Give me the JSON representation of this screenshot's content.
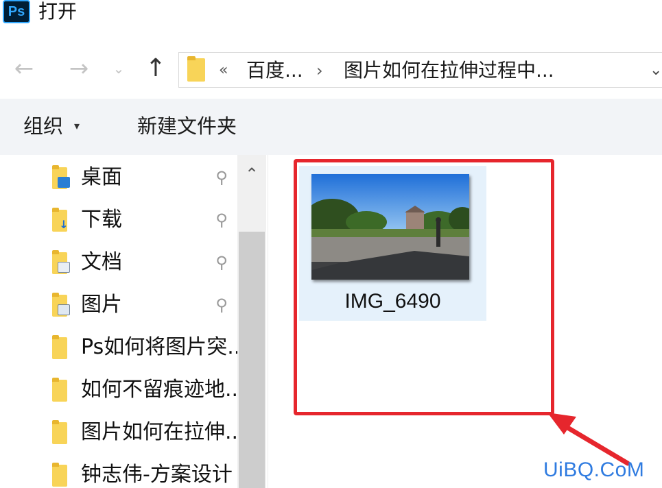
{
  "window": {
    "app_icon": "photoshop-icon",
    "app_icon_text": "Ps",
    "title": "打开"
  },
  "nav": {
    "back_icon": "arrow-left-icon",
    "forward_icon": "arrow-right-icon",
    "recent_icon": "chevron-down-icon",
    "up_icon": "arrow-up-icon",
    "address": {
      "overflow_symbol": "«",
      "segments": [
        "百度...",
        "图片如何在拉伸过程中..."
      ],
      "separator": "›",
      "dropdown_icon": "chevron-down-icon"
    }
  },
  "toolbar": {
    "organize_label": "组织",
    "organize_caret": "▾",
    "new_folder_label": "新建文件夹"
  },
  "sidebar": {
    "items": [
      {
        "label": "桌面",
        "icon": "desktop-folder-icon",
        "pinned": true
      },
      {
        "label": "下载",
        "icon": "downloads-folder-icon",
        "pinned": true
      },
      {
        "label": "文档",
        "icon": "documents-folder-icon",
        "pinned": true
      },
      {
        "label": "图片",
        "icon": "pictures-folder-icon",
        "pinned": true
      },
      {
        "label": "Ps如何将图片突...",
        "icon": "folder-icon",
        "pinned": false
      },
      {
        "label": "如何不留痕迹地...",
        "icon": "folder-icon",
        "pinned": false
      },
      {
        "label": "图片如何在拉伸...",
        "icon": "folder-icon",
        "pinned": false
      },
      {
        "label": "钟志伟-方案设计",
        "icon": "folder-icon",
        "pinned": false
      }
    ],
    "pin_icon": "pin-icon",
    "pin_symbol": "📌"
  },
  "scrollbar": {
    "up_icon": "caret-up-icon",
    "up_symbol": "⌃"
  },
  "files": [
    {
      "name": "IMG_6490",
      "type": "image-thumbnail",
      "selected": true
    }
  ],
  "annotation": {
    "box_color": "#e6262d",
    "arrow_color": "#e6262d"
  },
  "watermark": {
    "text": "UiBQ.CoM",
    "color": "#2f7be0"
  },
  "colors": {
    "selection": "#e5f1fb",
    "toolbar_bg": "#f2f4f7",
    "folder": "#f8d458"
  }
}
